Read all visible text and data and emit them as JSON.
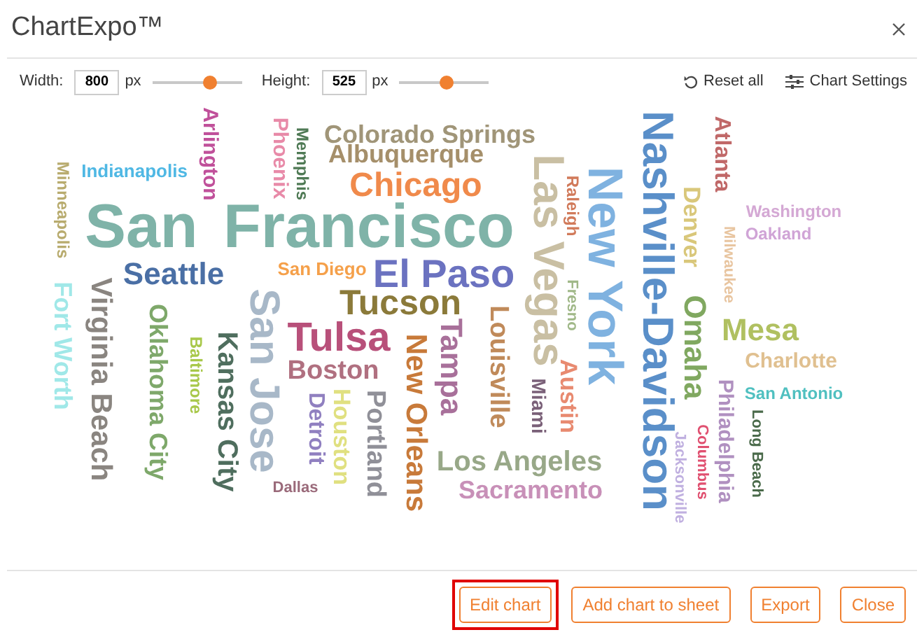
{
  "window": {
    "title": "ChartExpo™"
  },
  "toolbar": {
    "width": {
      "label": "Width:",
      "value": "800",
      "unit": "px",
      "level": 0.65
    },
    "height": {
      "label": "Height:",
      "value": "525",
      "unit": "px",
      "level": 0.52
    },
    "reset": "Reset all",
    "settings": "Chart Settings"
  },
  "words": [
    {
      "text": "Minneapolis",
      "color": "#b8ab6e",
      "kind": "vertical"
    },
    {
      "text": "Indianapolis",
      "color": "#4fb8e4",
      "kind": "horizontal"
    },
    {
      "text": "Arlington",
      "color": "#c0509a",
      "kind": "vertical"
    },
    {
      "text": "Phoenix",
      "color": "#e88aa8",
      "kind": "vertical"
    },
    {
      "text": "Memphis",
      "color": "#4f7a55",
      "kind": "vertical"
    },
    {
      "text": "Colorado Springs",
      "color": "#a09578",
      "kind": "horizontal"
    },
    {
      "text": "Albuquerque",
      "color": "#a58f6a",
      "kind": "horizontal"
    },
    {
      "text": "Chicago",
      "color": "#f08a4b",
      "kind": "horizontal"
    },
    {
      "text": "San Francisco",
      "color": "#7fb3a8",
      "kind": "horizontal"
    },
    {
      "text": "Las Vegas",
      "color": "#c9bfa3",
      "kind": "vertical"
    },
    {
      "text": "Raleigh",
      "color": "#d17a5a",
      "kind": "vertical"
    },
    {
      "text": "New York",
      "color": "#7fb2e0",
      "kind": "vertical"
    },
    {
      "text": "Nashville-Davidson",
      "color": "#5a8fc9",
      "kind": "vertical"
    },
    {
      "text": "Atlanta",
      "color": "#c06868",
      "kind": "vertical"
    },
    {
      "text": "Denver",
      "color": "#d9c77a",
      "kind": "vertical"
    },
    {
      "text": "Milwaukee",
      "color": "#e8c5a0",
      "kind": "vertical"
    },
    {
      "text": "Washington",
      "color": "#d4a8d4",
      "kind": "horizontal"
    },
    {
      "text": "Oakland",
      "color": "#d0a4d6",
      "kind": "horizontal"
    },
    {
      "text": "Seattle",
      "color": "#4a6fa5",
      "kind": "horizontal"
    },
    {
      "text": "San Diego",
      "color": "#f5a04a",
      "kind": "horizontal"
    },
    {
      "text": "El Paso",
      "color": "#6b72c0",
      "kind": "horizontal"
    },
    {
      "text": "Tucson",
      "color": "#8b7a3a",
      "kind": "horizontal"
    },
    {
      "text": "Virginia Beach",
      "color": "#8a8580",
      "kind": "vertical"
    },
    {
      "text": "Fort Worth",
      "color": "#a0e8e8",
      "kind": "vertical"
    },
    {
      "text": "Oklahoma City",
      "color": "#7ea86a",
      "kind": "vertical"
    },
    {
      "text": "Baltimore",
      "color": "#a8c84a",
      "kind": "vertical"
    },
    {
      "text": "Kansas City",
      "color": "#4f6e5e",
      "kind": "vertical"
    },
    {
      "text": "San Jose",
      "color": "#a8b8c8",
      "kind": "vertical"
    },
    {
      "text": "Tulsa",
      "color": "#b8507a",
      "kind": "horizontal"
    },
    {
      "text": "Boston",
      "color": "#b07080",
      "kind": "horizontal"
    },
    {
      "text": "Detroit",
      "color": "#9080c0",
      "kind": "vertical"
    },
    {
      "text": "Houston",
      "color": "#e0e080",
      "kind": "vertical"
    },
    {
      "text": "Portland",
      "color": "#909098",
      "kind": "vertical"
    },
    {
      "text": "New Orleans",
      "color": "#c87a3a",
      "kind": "vertical"
    },
    {
      "text": "Tampa",
      "color": "#a8709a",
      "kind": "vertical"
    },
    {
      "text": "Louisville",
      "color": "#c08a5a",
      "kind": "vertical"
    },
    {
      "text": "Dallas",
      "color": "#9a6a7a",
      "kind": "horizontal"
    },
    {
      "text": "Los Angeles",
      "color": "#98a888",
      "kind": "horizontal"
    },
    {
      "text": "Sacramento",
      "color": "#c890b8",
      "kind": "horizontal"
    },
    {
      "text": "Fresno",
      "color": "#a0b888",
      "kind": "vertical"
    },
    {
      "text": "Austin",
      "color": "#e88a70",
      "kind": "vertical"
    },
    {
      "text": "Miami",
      "color": "#7a6078",
      "kind": "vertical"
    },
    {
      "text": "Omaha",
      "color": "#80a860",
      "kind": "vertical"
    },
    {
      "text": "Jacksonville",
      "color": "#c0b0e0",
      "kind": "vertical"
    },
    {
      "text": "Columbus",
      "color": "#e05070",
      "kind": "vertical"
    },
    {
      "text": "Philadelphia",
      "color": "#b090c0",
      "kind": "vertical"
    },
    {
      "text": "Mesa",
      "color": "#b0c060",
      "kind": "horizontal"
    },
    {
      "text": "Charlotte",
      "color": "#e0c090",
      "kind": "horizontal"
    },
    {
      "text": "San Antonio",
      "color": "#50c0c0",
      "kind": "horizontal"
    },
    {
      "text": "Long Beach",
      "color": "#4a6a4a",
      "kind": "vertical"
    }
  ],
  "buttons": [
    {
      "label": "Edit chart",
      "highlighted": true
    },
    {
      "label": "Add chart to sheet",
      "highlighted": false
    },
    {
      "label": "Export",
      "highlighted": false
    },
    {
      "label": "Close",
      "highlighted": false
    }
  ]
}
